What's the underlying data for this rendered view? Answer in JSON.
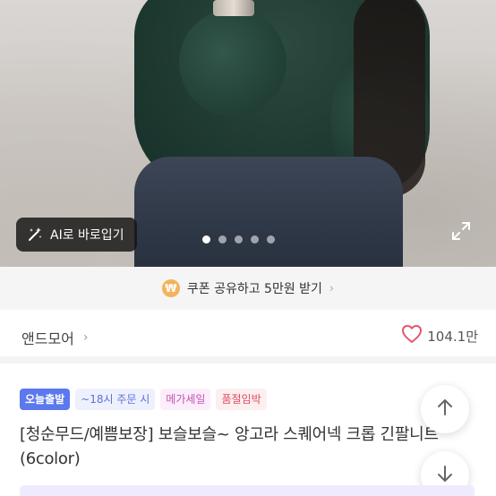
{
  "image": {
    "ai_button_label": "AI로 바로입기",
    "carousel": {
      "total": 5,
      "active_index": 0
    }
  },
  "coupon": {
    "badge_symbol": "₩",
    "text": "쿠폰 공유하고 5만원 받기",
    "arrow": "›"
  },
  "brand": {
    "name": "앤드모어",
    "arrow": "›",
    "like_count": "104.1만"
  },
  "badges": {
    "today": "오늘출발",
    "order_time": "~18시 주문 시",
    "mega_sale": "메가세일",
    "sold_out_soon": "품절임박"
  },
  "product": {
    "title": "[청순무드/예쁨보장] 보슬보슬~ 앙고라 스퀘어넥 크롭 긴팔니트 (6color)"
  },
  "colors": {
    "accent_blue": "#5b78ee",
    "heart": "#e5566b",
    "coupon_won": "#f3b35c"
  }
}
